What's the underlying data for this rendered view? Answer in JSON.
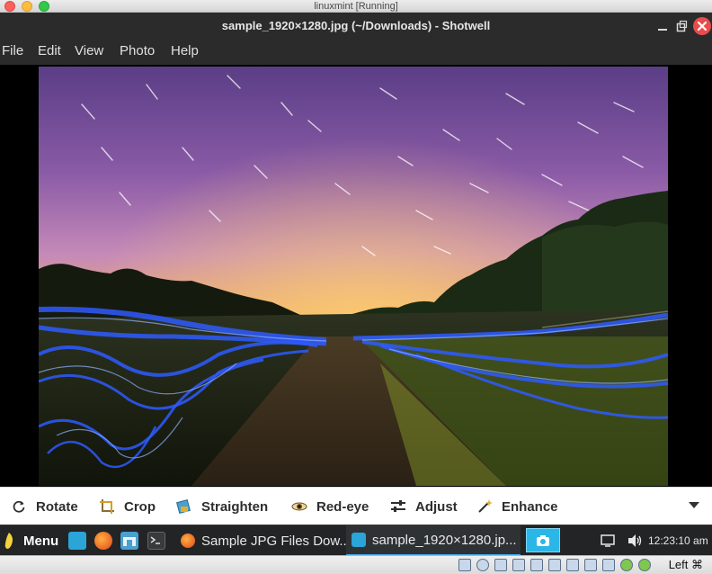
{
  "host_window": {
    "title": "linuxmint [Running]"
  },
  "app": {
    "title": "sample_1920×1280.jpg (~/Downloads) - Shotwell",
    "window_controls": [
      "minimize-icon",
      "maximize-icon",
      "close-icon"
    ]
  },
  "menubar": {
    "items": [
      "File",
      "Edit",
      "View",
      "Photo",
      "Help"
    ]
  },
  "toolbar": {
    "items": [
      {
        "label": "Rotate",
        "icon": "rotate-icon"
      },
      {
        "label": "Crop",
        "icon": "crop-icon"
      },
      {
        "label": "Straighten",
        "icon": "straighten-icon"
      },
      {
        "label": "Red-eye",
        "icon": "red-eye-icon"
      },
      {
        "label": "Adjust",
        "icon": "adjust-icon"
      },
      {
        "label": "Enhance",
        "icon": "enhance-icon"
      }
    ],
    "overflow_icon": "chevron-down-icon"
  },
  "taskbar": {
    "menu_label": "Menu",
    "launchers": [
      "show-desktop-icon",
      "firefox-icon",
      "files-icon",
      "terminal-icon"
    ],
    "tasks": [
      {
        "label": "Sample JPG Files Dow...",
        "icon": "firefox-icon",
        "active": false
      },
      {
        "label": "sample_1920×1280.jp...",
        "icon": "shotwell-icon",
        "active": true
      }
    ],
    "clock": "12:23:10 am",
    "tray_icons": [
      "window-list-icon",
      "volume-icon"
    ]
  },
  "vbox_status": {
    "host_key": "Left ⌘"
  },
  "colors": {
    "accent": "#4aa8e6",
    "close": "#e84c4c",
    "taskbar": "#232425"
  }
}
